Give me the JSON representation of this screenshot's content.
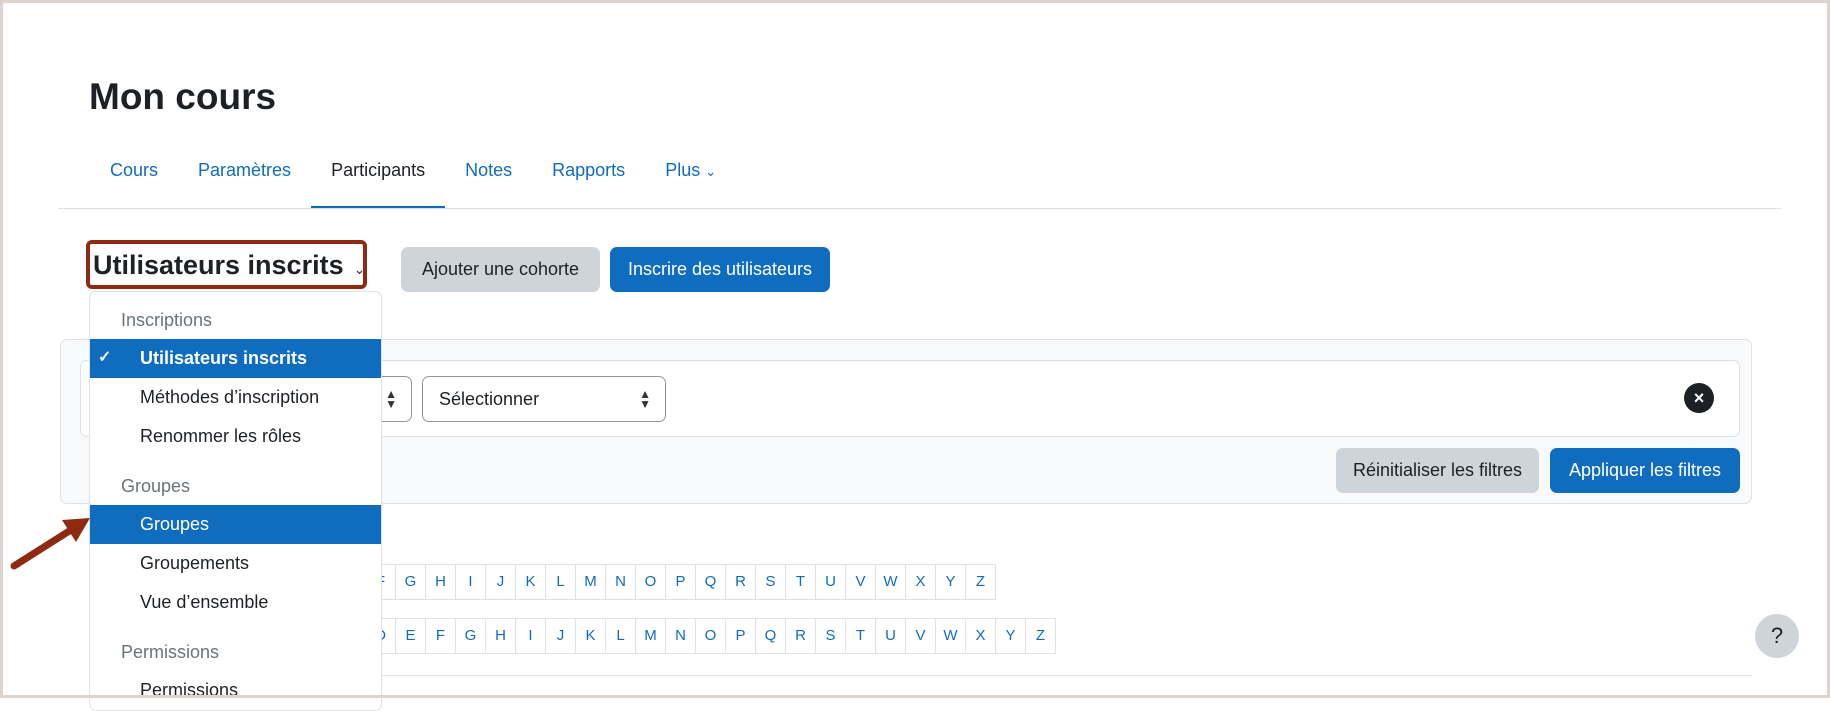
{
  "page_title": "Mon cours",
  "nav": [
    {
      "label": "Cours"
    },
    {
      "label": "Paramètres"
    },
    {
      "label": "Participants",
      "active": true
    },
    {
      "label": "Notes"
    },
    {
      "label": "Rapports"
    },
    {
      "label": "Plus"
    }
  ],
  "heading": {
    "label": "Utilisateurs inscrits",
    "chevron": "⌄"
  },
  "buttons": {
    "add_cohort": "Ajouter une cohorte",
    "enrol_users": "Inscrire des utilisateurs",
    "reset_filters": "Réinitialiser les filtres",
    "apply_filters": "Appliquer les filtres"
  },
  "filter": {
    "select_value": "Sélectionner",
    "clear_icon": "×"
  },
  "letters_row1": [
    "F",
    "G",
    "H",
    "I",
    "J",
    "K",
    "L",
    "M",
    "N",
    "O",
    "P",
    "Q",
    "R",
    "S",
    "T",
    "U",
    "V",
    "W",
    "X",
    "Y",
    "Z"
  ],
  "letters_row2": [
    "D",
    "E",
    "F",
    "G",
    "H",
    "I",
    "J",
    "K",
    "L",
    "M",
    "N",
    "O",
    "P",
    "Q",
    "R",
    "S",
    "T",
    "U",
    "V",
    "W",
    "X",
    "Y",
    "Z"
  ],
  "menu": {
    "h1": "Inscriptions",
    "i1": "Utilisateurs inscrits",
    "i2": "Méthodes d’inscription",
    "i3": "Renommer les rôles",
    "h2": "Groupes",
    "i4": "Groupes",
    "i5": "Groupements",
    "i6": "Vue d’ensemble",
    "h3": "Permissions",
    "i7": "Permissions"
  },
  "help": "?",
  "colors": {
    "primary": "#0f6cbf",
    "highlight_border": "#8e2a12",
    "arrow": "#8e2a12"
  }
}
